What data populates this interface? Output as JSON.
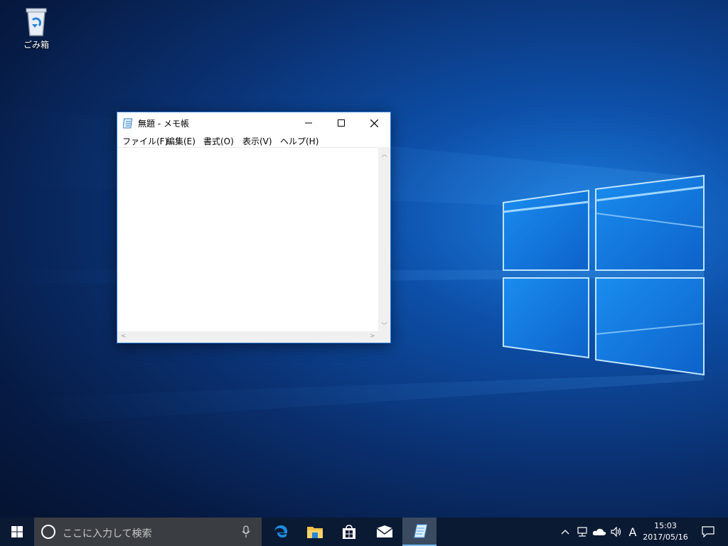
{
  "desktop": {
    "icons": [
      {
        "label": "ごみ箱",
        "icon": "recycle-bin-icon"
      }
    ]
  },
  "notepad": {
    "title": "無題 - メモ帳",
    "menu": [
      "ファイル(F)",
      "編集(E)",
      "書式(O)",
      "表示(V)",
      "ヘルプ(H)"
    ],
    "content": ""
  },
  "taskbar": {
    "search_placeholder": "ここに入力して検索",
    "apps": [
      "edge-icon",
      "file-explorer-icon",
      "store-icon",
      "mail-icon",
      "notepad-icon"
    ],
    "active_app": "notepad-icon",
    "tray": {
      "ime_mode": "A",
      "time": "15:03",
      "date": "2017/05/16"
    }
  },
  "colors": {
    "accent": "#2b7bd6",
    "taskbar": "#0b1a33",
    "search_box": "#3a3d42"
  }
}
